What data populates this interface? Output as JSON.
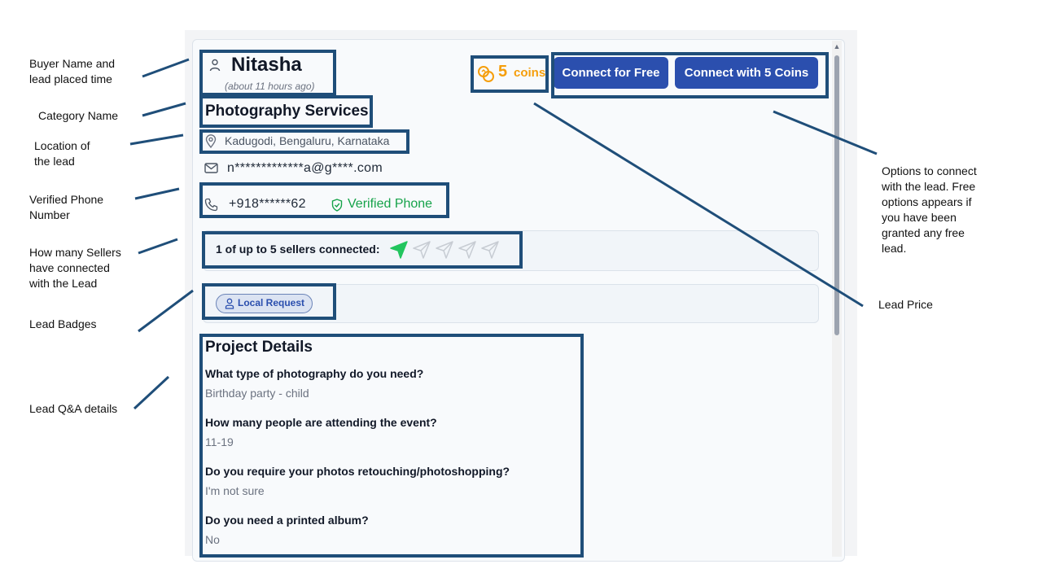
{
  "lead": {
    "buyer_name": "Nitasha",
    "time_ago": "(about 11 hours ago)",
    "coins_number": "5",
    "coins_word": "coins",
    "connect_free_label": "Connect for Free",
    "connect_coins_label": "Connect with 5 Coins",
    "category": "Photography Services",
    "location": "Kadugodi, Bengaluru, Karnataka",
    "email": "n*************a@g****.com",
    "phone": "+918******62",
    "verified_label": "Verified Phone",
    "sellers_text": "1 of up to 5 sellers connected:",
    "sellers_connected": 1,
    "sellers_max": 5,
    "badge_label": "Local Request",
    "project_title": "Project Details",
    "qa": [
      {
        "q": "What type of photography do you need?",
        "a": "Birthday party - child"
      },
      {
        "q": "How many people are attending the event?",
        "a": "11-19"
      },
      {
        "q": "Do you require your photos retouching/photoshopping?",
        "a": "I'm not sure"
      },
      {
        "q": "Do you need a printed album?",
        "a": "No"
      }
    ]
  },
  "annotations": {
    "buyer": [
      "Buyer Name and",
      "lead placed time"
    ],
    "category": [
      "Category Name"
    ],
    "location": [
      "Location of",
      "the lead"
    ],
    "phone": [
      "Verified Phone",
      "Number"
    ],
    "sellers": [
      "How many Sellers",
      "have connected",
      "with the Lead"
    ],
    "badges": [
      "Lead Badges"
    ],
    "qa": [
      "Lead Q&A details"
    ],
    "options": [
      "Options to connect",
      "with the lead. Free",
      "options appears if",
      "you have been",
      "granted any free",
      "lead."
    ],
    "price": [
      "Lead Price"
    ]
  },
  "colors": {
    "annotation_box": "#1f4e79",
    "primary_button": "#2b4fae",
    "coins": "#f59e0b",
    "verified": "#16a34a",
    "active_send": "#22c55e"
  },
  "icons": [
    "user-icon",
    "coins-icon",
    "location-pin-icon",
    "mail-icon",
    "phone-icon",
    "shield-check-icon",
    "send-icon",
    "badge-user-icon"
  ]
}
